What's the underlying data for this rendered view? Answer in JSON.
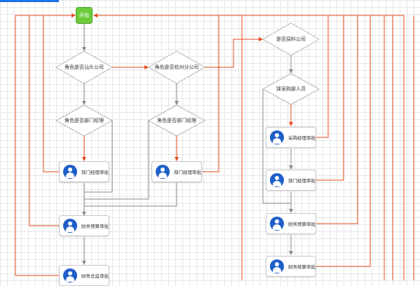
{
  "start": {
    "label": "开始"
  },
  "decisions": {
    "is_shantou": "角色是否汕头公司",
    "is_hangzhou": "角色是否杭州分公司",
    "is_dept_manager_a": "角色是否部门经理",
    "is_dept_manager_b": "角色是否部门经理",
    "is_supplier": "是否採料公司",
    "is_purchaser": "球采购部人员"
  },
  "tasks": {
    "dept_manager_approval_a": "部门经理审批",
    "dept_manager_approval_b": "部门经理审批",
    "finance_budget_approval": "财务预算审批",
    "finance_director_approval": "财务总监审批",
    "purchase_manager_approval": "采购经理审批",
    "dept_manager_approval_c": "部门经理审批",
    "finance_budget_approval_b": "财务预算审批",
    "finance_settlement_approval": "财务核算审批"
  },
  "colors": {
    "flow_red": "#e8491d",
    "flow_gray": "#8a8a8a",
    "start_green": "#6ccb3b",
    "avatar_blue": "#1f5fc9"
  }
}
